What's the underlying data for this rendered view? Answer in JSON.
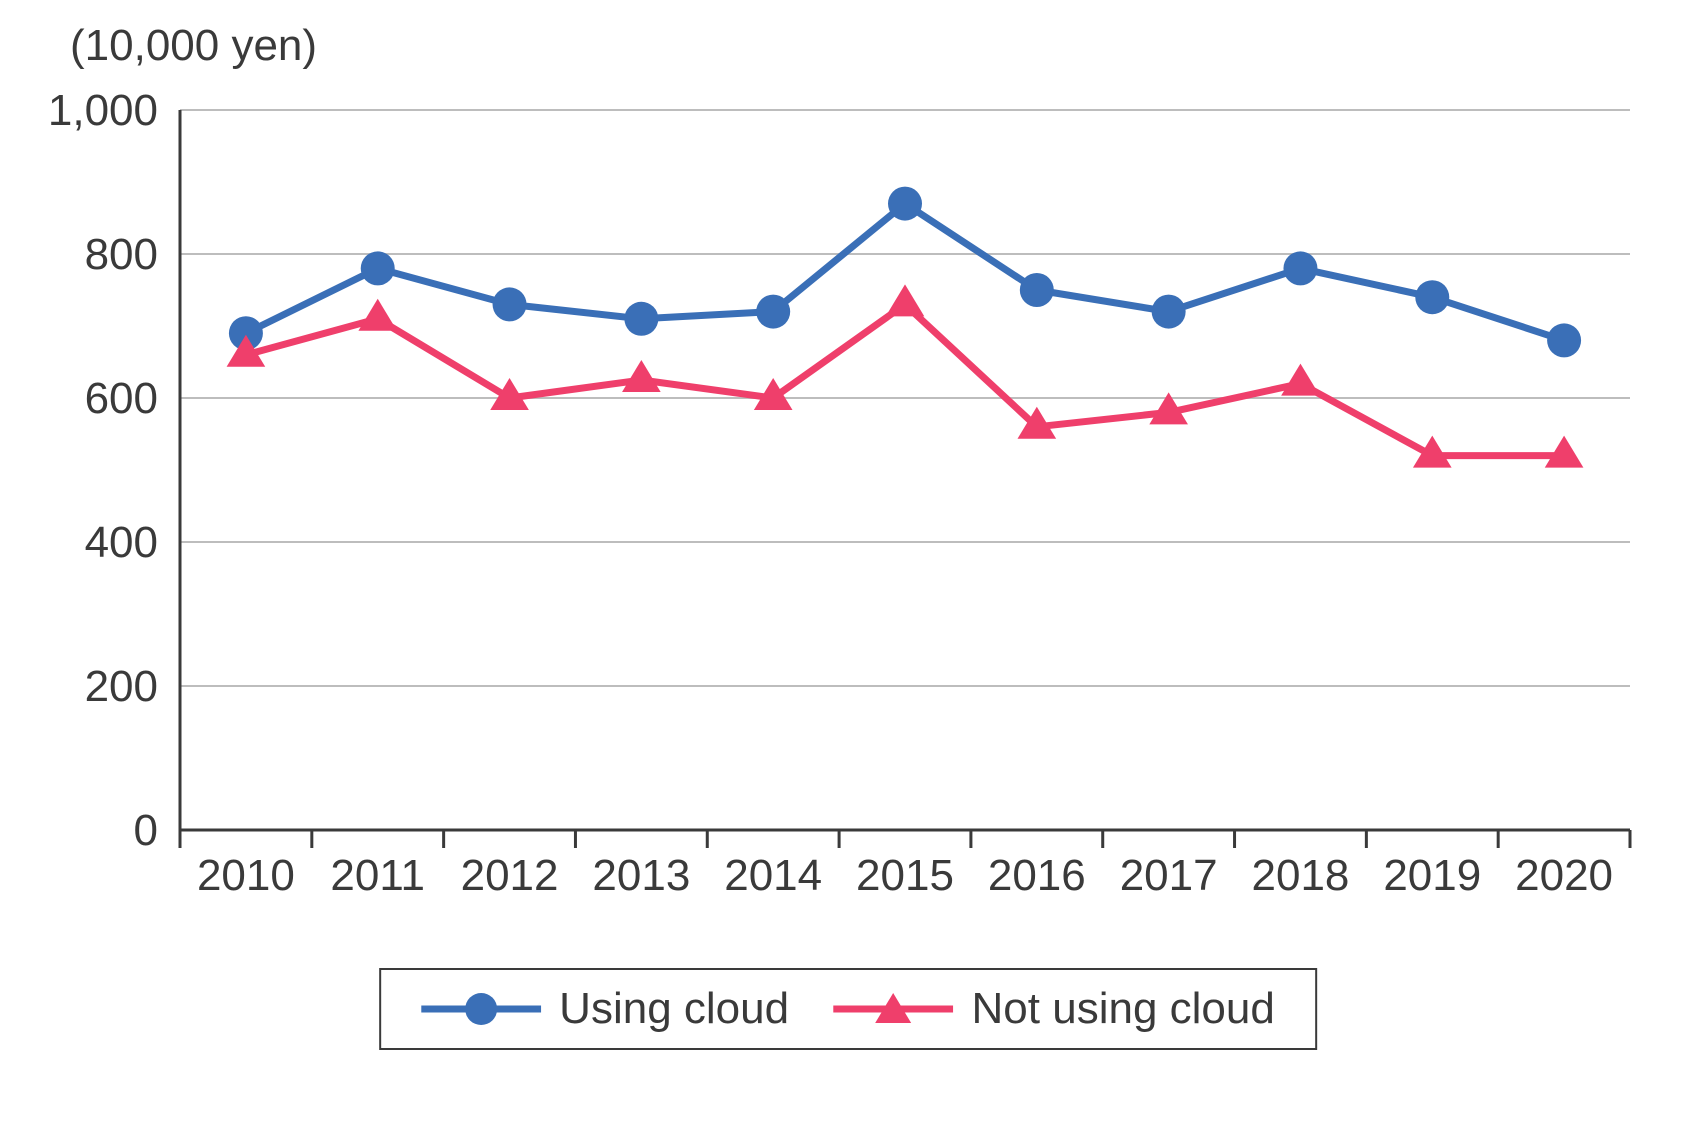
{
  "chart_data": {
    "type": "line",
    "unit_label": "(10,000 yen)",
    "categories": [
      "2010",
      "2011",
      "2012",
      "2013",
      "2014",
      "2015",
      "2016",
      "2017",
      "2018",
      "2019",
      "2020"
    ],
    "series": [
      {
        "name": "Using cloud",
        "values": [
          690,
          780,
          730,
          710,
          720,
          870,
          750,
          720,
          780,
          740,
          680
        ],
        "color": "#3a6fb7",
        "marker": "circle"
      },
      {
        "name": "Not using cloud",
        "values": [
          660,
          710,
          600,
          625,
          600,
          730,
          560,
          580,
          620,
          520,
          520
        ],
        "color": "#ef3f6b",
        "marker": "triangle"
      }
    ],
    "ylim": [
      0,
      1000
    ],
    "yticks": [
      0,
      200,
      400,
      600,
      800,
      1000
    ],
    "xlabel": "",
    "ylabel": ""
  },
  "legend": {
    "items": [
      {
        "label": "Using cloud"
      },
      {
        "label": "Not using cloud"
      }
    ]
  }
}
